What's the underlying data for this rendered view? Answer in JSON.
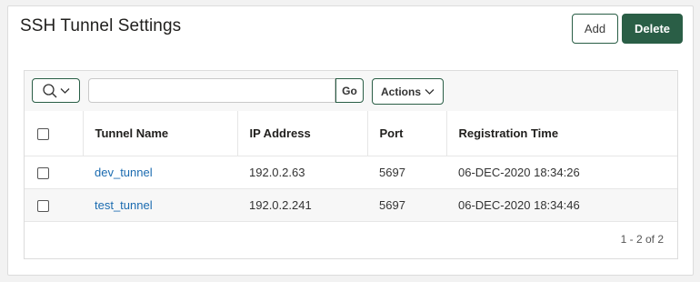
{
  "region": {
    "title": "SSH Tunnel Settings",
    "add_label": "Add",
    "delete_label": "Delete"
  },
  "toolbar": {
    "search_icon": "search-icon",
    "search_value": "",
    "go_label": "Go",
    "actions_label": "Actions"
  },
  "table": {
    "headers": [
      "Tunnel Name",
      "IP Address",
      "Port",
      "Registration Time"
    ],
    "rows": [
      {
        "checked": false,
        "tunnel_name": "dev_tunnel",
        "ip_address": "192.0.2.63",
        "port": "5697",
        "registration_time": "06-DEC-2020 18:34:26"
      },
      {
        "checked": false,
        "tunnel_name": "test_tunnel",
        "ip_address": "192.0.2.241",
        "port": "5697",
        "registration_time": "06-DEC-2020 18:34:46"
      }
    ]
  },
  "pagination": {
    "label": "1 - 2 of 2"
  },
  "colors": {
    "primary": "#2a5e46",
    "link": "#1b6bb0",
    "border": "#dcdcdc"
  }
}
